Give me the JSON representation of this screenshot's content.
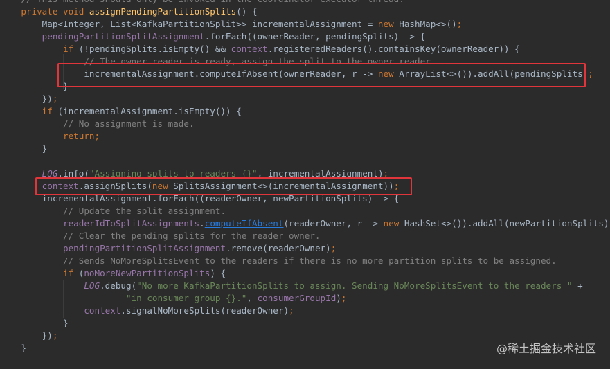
{
  "editor": {
    "lines": [
      [
        {
          "t": "    // This method should only be invoked in the coordinator executor thread.",
          "c": "cm"
        }
      ],
      [
        {
          "t": "    ",
          "c": "pl"
        },
        {
          "t": "private void ",
          "c": "kw"
        },
        {
          "t": "assignPendingPartitionSplits",
          "c": "fn"
        },
        {
          "t": "() {",
          "c": "pl"
        }
      ],
      [
        {
          "t": "        Map<Integer, List<KafkaPartitionSplit>> incrementalAssignment = ",
          "c": "pl"
        },
        {
          "t": "new ",
          "c": "kw"
        },
        {
          "t": "HashMap<>()",
          "c": "pl"
        },
        {
          "t": ";",
          "c": "kw"
        }
      ],
      [
        {
          "t": "        ",
          "c": "pl"
        },
        {
          "t": "pendingPartitionSplitAssignment",
          "c": "fld"
        },
        {
          "t": ".forEach((ownerReader, pendingSplits) -> {",
          "c": "pl"
        }
      ],
      [
        {
          "t": "            ",
          "c": "pl"
        },
        {
          "t": "if ",
          "c": "kw"
        },
        {
          "t": "(!pendingSplits.isEmpty() && ",
          "c": "pl"
        },
        {
          "t": "context",
          "c": "fld"
        },
        {
          "t": ".registeredReaders().containsKey(ownerReader)) {",
          "c": "pl"
        }
      ],
      [
        {
          "t": "                // The owner reader is ready, assign the split to the owner reader.",
          "c": "cm"
        }
      ],
      [
        {
          "t": "                ",
          "c": "pl"
        },
        {
          "t": "incrementalAssignment",
          "c": "ul"
        },
        {
          "t": ".computeIfAbsent(ownerReader, r -> ",
          "c": "pl"
        },
        {
          "t": "new ",
          "c": "kw"
        },
        {
          "t": "ArrayList<>()).addAll(pendingSplits)",
          "c": "pl"
        },
        {
          "t": ";",
          "c": "kw"
        }
      ],
      [
        {
          "t": "            }",
          "c": "pl"
        }
      ],
      [
        {
          "t": "        })",
          "c": "pl"
        },
        {
          "t": ";",
          "c": "kw"
        }
      ],
      [
        {
          "t": "        ",
          "c": "pl"
        },
        {
          "t": "if ",
          "c": "kw"
        },
        {
          "t": "(incrementalAssignment.isEmpty()) {",
          "c": "pl"
        }
      ],
      [
        {
          "t": "            // No assignment is made.",
          "c": "cm"
        }
      ],
      [
        {
          "t": "            ",
          "c": "pl"
        },
        {
          "t": "return;",
          "c": "kw"
        }
      ],
      [
        {
          "t": "        }",
          "c": "pl"
        }
      ],
      [
        {
          "t": "",
          "c": "pl"
        }
      ],
      [
        {
          "t": "        ",
          "c": "pl"
        },
        {
          "t": "LOG",
          "c": "fld-i"
        },
        {
          "t": ".info(",
          "c": "pl"
        },
        {
          "t": "\"Assigning splits to readers {}\"",
          "c": "st"
        },
        {
          "t": ", incrementalAssignment)",
          "c": "pl"
        },
        {
          "t": ";",
          "c": "kw"
        }
      ],
      [
        {
          "t": "        ",
          "c": "pl"
        },
        {
          "t": "context",
          "c": "fld"
        },
        {
          "t": ".assignSplits(",
          "c": "pl"
        },
        {
          "t": "new ",
          "c": "kw"
        },
        {
          "t": "SplitsAssignment<>(incrementalAssignment))",
          "c": "pl"
        },
        {
          "t": ";",
          "c": "kw"
        }
      ],
      [
        {
          "t": "        incrementalAssignment.forEach((readerOwner, newPartitionSplits) -> {",
          "c": "pl"
        }
      ],
      [
        {
          "t": "            // Update the split assignment.",
          "c": "cm"
        }
      ],
      [
        {
          "t": "            ",
          "c": "pl"
        },
        {
          "t": "readerIdToSplitAssignments",
          "c": "fld"
        },
        {
          "t": ".",
          "c": "pl"
        },
        {
          "t": "computeIfAbsent",
          "c": "lk"
        },
        {
          "t": "(readerOwner, r -> ",
          "c": "pl"
        },
        {
          "t": "new ",
          "c": "kw"
        },
        {
          "t": "HashSet<>()).addAll(newPartitionSplits)",
          "c": "pl"
        },
        {
          "t": ";",
          "c": "kw"
        }
      ],
      [
        {
          "t": "            // Clear the pending splits for the reader owner.",
          "c": "cm"
        }
      ],
      [
        {
          "t": "            ",
          "c": "pl"
        },
        {
          "t": "pendingPartitionSplitAssignment",
          "c": "fld"
        },
        {
          "t": ".remove(readerOwner)",
          "c": "pl"
        },
        {
          "t": ";",
          "c": "kw"
        }
      ],
      [
        {
          "t": "            // Sends NoMoreSplitsEvent to the readers if there is no more partition splits to be assigned.",
          "c": "cm"
        }
      ],
      [
        {
          "t": "            ",
          "c": "pl"
        },
        {
          "t": "if ",
          "c": "kw"
        },
        {
          "t": "(",
          "c": "pl"
        },
        {
          "t": "noMoreNewPartitionSplits",
          "c": "fld"
        },
        {
          "t": ") {",
          "c": "pl"
        }
      ],
      [
        {
          "t": "                ",
          "c": "pl"
        },
        {
          "t": "LOG",
          "c": "fld-i"
        },
        {
          "t": ".debug(",
          "c": "pl"
        },
        {
          "t": "\"No more KafkaPartitionSplits to assign. Sending NoMoreSplitsEvent to the readers \" ",
          "c": "st"
        },
        {
          "t": "+",
          "c": "pl"
        }
      ],
      [
        {
          "t": "                        ",
          "c": "pl"
        },
        {
          "t": "\"in consumer group {}.\"",
          "c": "st"
        },
        {
          "t": ", ",
          "c": "pl"
        },
        {
          "t": "consumerGroupId",
          "c": "fld"
        },
        {
          "t": ")",
          "c": "pl"
        },
        {
          "t": ";",
          "c": "kw"
        }
      ],
      [
        {
          "t": "                ",
          "c": "pl"
        },
        {
          "t": "context",
          "c": "fld"
        },
        {
          "t": ".signalNoMoreSplits(readerOwner)",
          "c": "pl"
        },
        {
          "t": ";",
          "c": "kw"
        }
      ],
      [
        {
          "t": "            }",
          "c": "pl"
        }
      ],
      [
        {
          "t": "        })",
          "c": "pl"
        },
        {
          "t": ";",
          "c": "kw"
        }
      ],
      [
        {
          "t": "    }",
          "c": "pl"
        }
      ]
    ]
  },
  "watermark": "@稀土掘金技术社区"
}
